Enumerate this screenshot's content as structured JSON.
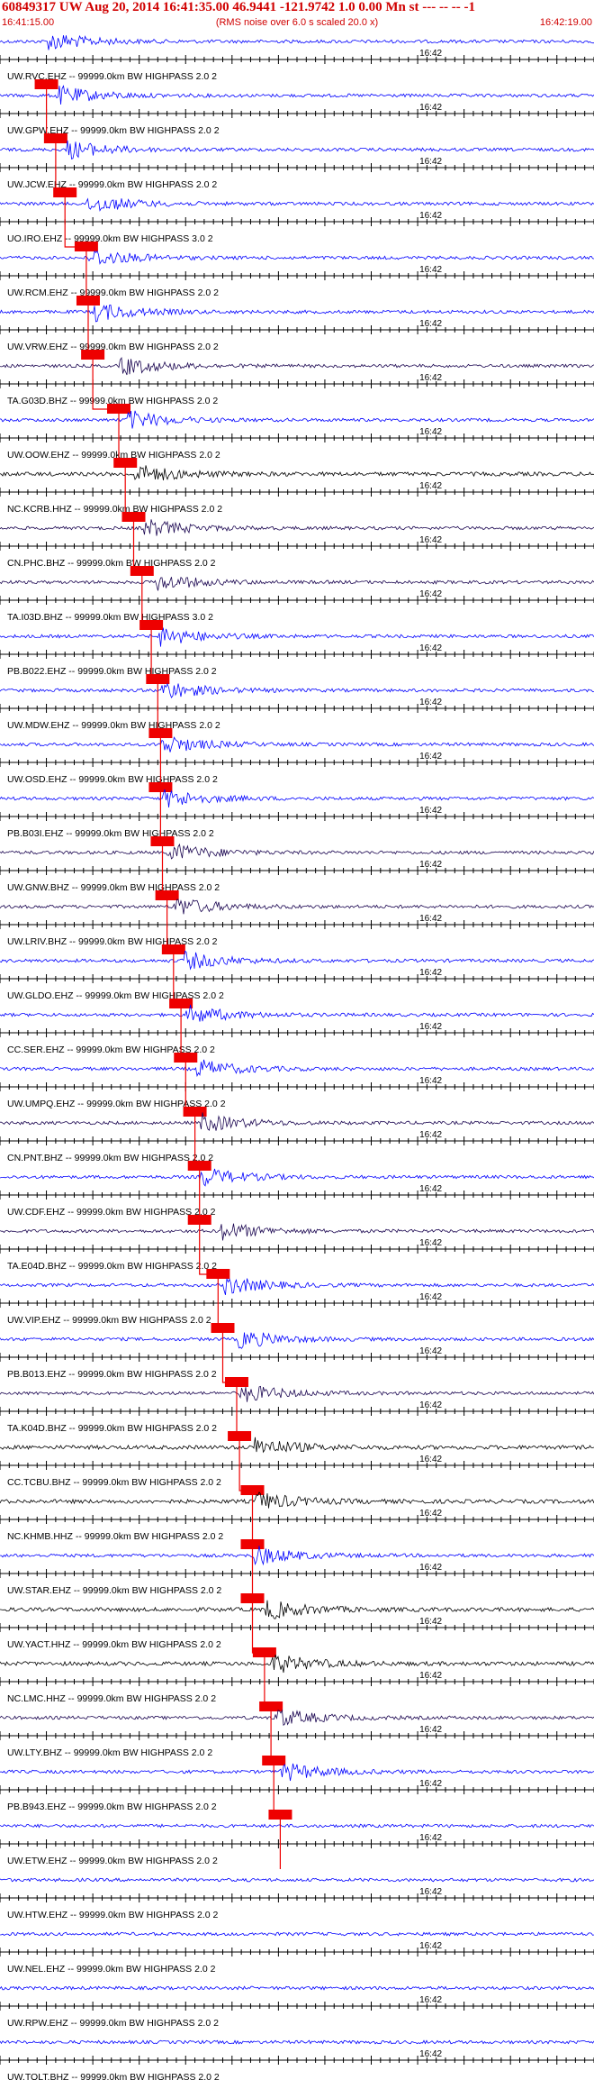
{
  "header": {
    "title": "60849317 UW Aug 20, 2014 16:41:35.00   46.9441 -121.9742  1.0 0.00 Mn st --- -- --  -1",
    "start_time": "16:41:15.00",
    "rms_note": "(RMS noise over 6.0 s scaled 20.0 x)",
    "end_time": "16:42:19.00"
  },
  "colors": {
    "header_text": "#d00000",
    "trace_blue": "#0000ff",
    "trace_dark": "#000000",
    "trace_purple": "#1a0550",
    "pick_marker": "#ee0000",
    "pick_line": "#ee0000",
    "axis": "#000000"
  },
  "chart_data": {
    "type": "line",
    "x_unit": "time (UTC)",
    "x_range": [
      "16:41:15.00",
      "16:42:19.00"
    ],
    "tick_interval_s": 1,
    "center_tick_label": "16:42",
    "stations": [
      {
        "label": "UW.RVC.EHZ -- 99999.0km BW  HIGHPASS  2.0  2",
        "color": "blue",
        "pick_time_s": 5
      },
      {
        "label": "UW.GPW.EHZ -- 99999.0km BW  HIGHPASS  2.0  2",
        "color": "blue",
        "pick_time_s": 6
      },
      {
        "label": "UW.JCW.EHZ -- 99999.0km BW  HIGHPASS  2.0  2",
        "color": "blue",
        "pick_time_s": 7
      },
      {
        "label": "UO.IRO.EHZ -- 99999.0km BW  HIGHPASS  3.0  2",
        "color": "blue",
        "pick_time_s": 9.3
      },
      {
        "label": "UW.RCM.EHZ -- 99999.0km BW  HIGHPASS  2.0  2",
        "color": "blue",
        "pick_time_s": 9.5
      },
      {
        "label": "UW.VRW.EHZ -- 99999.0km BW  HIGHPASS  2.0  2",
        "color": "blue",
        "pick_time_s": 10
      },
      {
        "label": "TA.G03D.BHZ -- 99999.0km BW  HIGHPASS  2.0  2",
        "color": "purple",
        "pick_time_s": 12.8
      },
      {
        "label": "UW.OOW.EHZ -- 99999.0km BW  HIGHPASS  2.0  2",
        "color": "blue",
        "pick_time_s": 13.5
      },
      {
        "label": "NC.KCRB.HHZ -- 99999.0km BW  HIGHPASS  2.0  2",
        "color": "dark",
        "pick_time_s": 14.4
      },
      {
        "label": "CN.PHC.BHZ -- 99999.0km BW  HIGHPASS  2.0  2",
        "color": "purple",
        "pick_time_s": 15.3
      },
      {
        "label": "TA.I03D.BHZ -- 99999.0km BW  HIGHPASS  3.0  2",
        "color": "purple",
        "pick_time_s": 16.3
      },
      {
        "label": "PB.B022.EHZ -- 99999.0km BW  HIGHPASS  2.0  2",
        "color": "blue",
        "pick_time_s": 17
      },
      {
        "label": "UW.MDW.EHZ -- 99999.0km BW  HIGHPASS  2.0  2",
        "color": "blue",
        "pick_time_s": 17.3
      },
      {
        "label": "UW.OSD.EHZ -- 99999.0km BW  HIGHPASS  2.0  2",
        "color": "blue",
        "pick_time_s": 17.3
      },
      {
        "label": "PB.B03I.EHZ -- 99999.0km BW  HIGHPASS  2.0  2",
        "color": "blue",
        "pick_time_s": 17.5
      },
      {
        "label": "UW.GNW.BHZ -- 99999.0km BW  HIGHPASS  2.0  2",
        "color": "purple",
        "pick_time_s": 18
      },
      {
        "label": "UW.LRIV.BHZ -- 99999.0km BW  HIGHPASS  2.0  2",
        "color": "purple",
        "pick_time_s": 18.7
      },
      {
        "label": "UW.GLDO.EHZ -- 99999.0km BW  HIGHPASS  2.0  2",
        "color": "blue",
        "pick_time_s": 19.5
      },
      {
        "label": "CC.SER.EHZ -- 99999.0km BW  HIGHPASS  2.0  2",
        "color": "blue",
        "pick_time_s": 20
      },
      {
        "label": "UW.UMPQ.EHZ -- 99999.0km BW  HIGHPASS  2.0  2",
        "color": "blue",
        "pick_time_s": 21
      },
      {
        "label": "CN.PNT.BHZ -- 99999.0km BW  HIGHPASS  2.0  2",
        "color": "purple",
        "pick_time_s": 21.5
      },
      {
        "label": "UW.CDF.EHZ -- 99999.0km BW  HIGHPASS  2.0  2",
        "color": "blue",
        "pick_time_s": 21.5
      },
      {
        "label": "TA.E04D.BHZ -- 99999.0km BW  HIGHPASS  2.0  2",
        "color": "purple",
        "pick_time_s": 23.5
      },
      {
        "label": "UW.VIP.EHZ -- 99999.0km BW  HIGHPASS  2.0  2",
        "color": "blue",
        "pick_time_s": 24
      },
      {
        "label": "PB.B013.EHZ -- 99999.0km BW  HIGHPASS  2.0  2",
        "color": "blue",
        "pick_time_s": 25.5
      },
      {
        "label": "TA.K04D.BHZ -- 99999.0km BW  HIGHPASS  2.0  2",
        "color": "purple",
        "pick_time_s": 25.8
      },
      {
        "label": "CC.TCBU.BHZ -- 99999.0km BW  HIGHPASS  2.0  2",
        "color": "dark",
        "pick_time_s": 27.2
      },
      {
        "label": "NC.KHMB.HHZ -- 99999.0km BW  HIGHPASS  2.0  2",
        "color": "dark",
        "pick_time_s": 27.2
      },
      {
        "label": "UW.STAR.EHZ -- 99999.0km BW  HIGHPASS  2.0  2",
        "color": "blue",
        "pick_time_s": 27.2
      },
      {
        "label": "UW.YACT.HHZ -- 99999.0km BW  HIGHPASS  2.0  2",
        "color": "dark",
        "pick_time_s": 28.5
      },
      {
        "label": "NC.LMC.HHZ -- 99999.0km BW  HIGHPASS  2.0  2",
        "color": "dark",
        "pick_time_s": 29.2
      },
      {
        "label": "UW.LTY.BHZ -- 99999.0km BW  HIGHPASS  2.0  2",
        "color": "purple",
        "pick_time_s": 29.5
      },
      {
        "label": "PB.B943.EHZ -- 99999.0km BW  HIGHPASS  2.0  2",
        "color": "blue",
        "pick_time_s": 30.2
      },
      {
        "label": "UW.ETW.EHZ -- 99999.0km BW  HIGHPASS  2.0  2",
        "color": "blue"
      },
      {
        "label": "UW.HTW.EHZ -- 99999.0km BW  HIGHPASS  2.0  2",
        "color": "blue"
      },
      {
        "label": "UW.NEL.EHZ -- 99999.0km BW  HIGHPASS  2.0  2",
        "color": "blue"
      },
      {
        "label": "UW.RPW.EHZ -- 99999.0km BW  HIGHPASS  2.0  2",
        "color": "blue"
      },
      {
        "label": "UW.TOLT.BHZ -- 99999.0km BW  HIGHPASS  2.0  2",
        "color": "blue"
      }
    ]
  }
}
